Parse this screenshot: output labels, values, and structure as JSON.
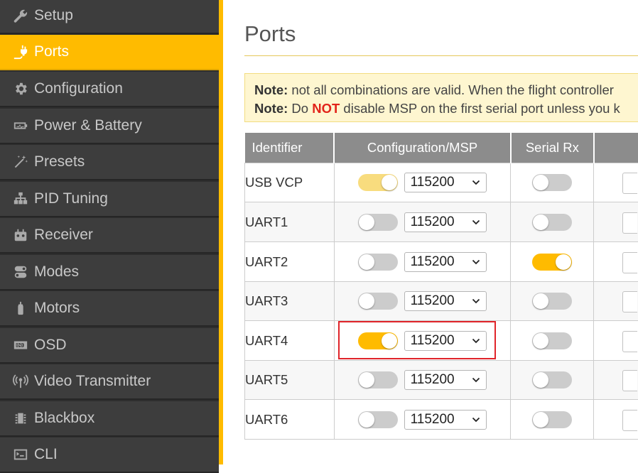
{
  "sidebar": {
    "items": [
      {
        "label": "Setup",
        "icon": "wrench-icon",
        "active": false
      },
      {
        "label": "Ports",
        "icon": "plug-icon",
        "active": true
      },
      {
        "label": "Configuration",
        "icon": "gear-icon",
        "active": false
      },
      {
        "label": "Power & Battery",
        "icon": "battery-icon",
        "active": false
      },
      {
        "label": "Presets",
        "icon": "magic-wand-icon",
        "active": false
      },
      {
        "label": "PID Tuning",
        "icon": "sitemap-icon",
        "active": false
      },
      {
        "label": "Receiver",
        "icon": "gamepad-icon",
        "active": false
      },
      {
        "label": "Modes",
        "icon": "toggles-icon",
        "active": false
      },
      {
        "label": "Motors",
        "icon": "motor-icon",
        "active": false
      },
      {
        "label": "OSD",
        "icon": "osd-icon",
        "active": false
      },
      {
        "label": "Video Transmitter",
        "icon": "antenna-icon",
        "active": false
      },
      {
        "label": "Blackbox",
        "icon": "chip-icon",
        "active": false
      },
      {
        "label": "CLI",
        "icon": "terminal-icon",
        "active": false
      }
    ]
  },
  "page": {
    "title": "Ports",
    "notes": [
      {
        "label": "Note:",
        "pre": " not all combinations are valid. When the flight controller",
        "emphasis": "",
        "post": ""
      },
      {
        "label": "Note:",
        "pre": " Do ",
        "emphasis": "NOT",
        "post": " disable MSP on the first serial port unless you k"
      }
    ]
  },
  "table": {
    "headers": [
      "Identifier",
      "Configuration/MSP",
      "Serial Rx",
      ""
    ],
    "rows": [
      {
        "id": "USB VCP",
        "msp": true,
        "msp_dim": true,
        "baud": "115200",
        "serial_rx": false
      },
      {
        "id": "UART1",
        "msp": false,
        "msp_dim": false,
        "baud": "115200",
        "serial_rx": false
      },
      {
        "id": "UART2",
        "msp": false,
        "msp_dim": false,
        "baud": "115200",
        "serial_rx": true
      },
      {
        "id": "UART3",
        "msp": false,
        "msp_dim": false,
        "baud": "115200",
        "serial_rx": false
      },
      {
        "id": "UART4",
        "msp": true,
        "msp_dim": false,
        "baud": "115200",
        "serial_rx": false
      },
      {
        "id": "UART5",
        "msp": false,
        "msp_dim": false,
        "baud": "115200",
        "serial_rx": false
      },
      {
        "id": "UART6",
        "msp": false,
        "msp_dim": false,
        "baud": "115200",
        "serial_rx": false
      }
    ]
  },
  "colors": {
    "accent": "#ffbb00",
    "sidebar_bg": "#3d3d3d",
    "header_bg": "#8c8c8c",
    "note_bg": "#fef6d0",
    "highlight": "#e0242a"
  }
}
